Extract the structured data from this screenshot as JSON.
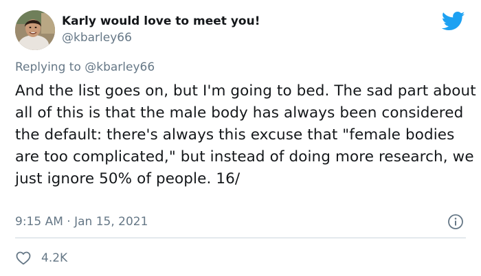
{
  "author": {
    "display_name": "Karly would love to meet you!",
    "handle": "@kbarley66"
  },
  "reply": {
    "prefix": "Replying to",
    "mention": "@kbarley66"
  },
  "tweet": {
    "text": "And the list goes on, but I'm going to bed. The sad part about all of this is that the male body has always been considered the default: there's always this excuse that \"female bodies are too complicated,\" but instead of doing more research, we just ignore 50% of people. 16/",
    "timestamp": "9:15 AM · Jan 15, 2021"
  },
  "engagement": {
    "likes": "4.2K"
  },
  "icons": {
    "brand": "twitter-bird-icon",
    "info": "info-icon",
    "like": "heart-icon"
  },
  "colors": {
    "brand": "#1da1f2",
    "text": "#14171a",
    "secondary": "#657786",
    "divider": "#ccd6dd"
  }
}
